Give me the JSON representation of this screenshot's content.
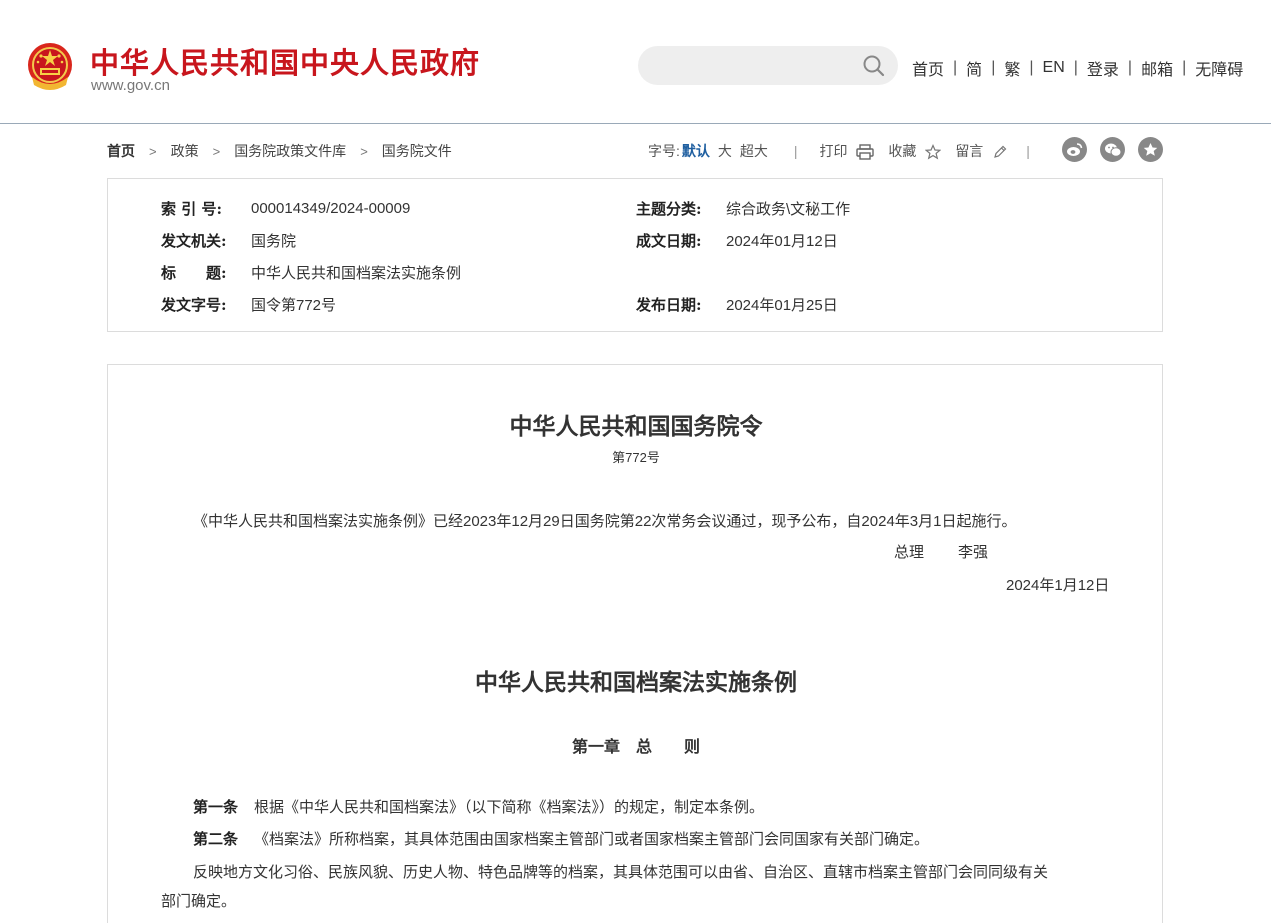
{
  "header": {
    "site_name": "中华人民共和国中央人民政府",
    "domain": "www.gov.cn",
    "search_placeholder": "",
    "nav": [
      "首页",
      "简",
      "繁",
      "EN",
      "登录",
      "邮箱",
      "无障碍"
    ],
    "brand_color": "#c8161d"
  },
  "breadcrumb": [
    "首页",
    "政策",
    "国务院政策文件库",
    "国务院文件"
  ],
  "toolbar": {
    "font_label": "字号:",
    "font_default": "默认",
    "font_large": "大",
    "font_xlarge": "超大",
    "print": "打印",
    "favorite": "收藏",
    "comment": "留言",
    "share_icons": [
      "weibo-icon",
      "wechat-icon",
      "star-icon"
    ]
  },
  "info": {
    "index_label": "索 引 号:",
    "index_value": "000014349/2024-00009",
    "subject_label": "主题分类:",
    "subject_value": "综合政务\\文秘工作",
    "issuer_label": "发文机关:",
    "issuer_value": "国务院",
    "date_written_label": "成文日期:",
    "date_written_value": "2024年01月12日",
    "title_label": "标　　题:",
    "title_value": "中华人民共和国档案法实施条例",
    "doc_no_label": "发文字号:",
    "doc_no_value": "国令第772号",
    "pub_date_label": "发布日期:",
    "pub_date_value": "2024年01月25日"
  },
  "article": {
    "order_title": "中华人民共和国国务院令",
    "order_number": "第772号",
    "intro": "《中华人民共和国档案法实施条例》已经2023年12月29日国务院第22次常务会议通过，现予公布，自2024年3月1日起施行。",
    "signer_title": "总理",
    "signer_name": "李强",
    "sign_date": "2024年1月12日",
    "regulation_title": "中华人民共和国档案法实施条例",
    "chapter_title": "第一章　总　　则",
    "art1_label": "第一条",
    "art1_text": "根据《中华人民共和国档案法》（以下简称《档案法》）的规定，制定本条例。",
    "art2_label": "第二条",
    "art2_text": "《档案法》所称档案，其具体范围由国家档案主管部门或者国家档案主管部门会同国家有关部门确定。",
    "art2_p2_line1": "反映地方文化习俗、民族风貌、历史人物、特色品牌等的档案，其具体范围可以由省、自治区、直辖市档案主管部门会同同级有关",
    "art2_p2_line2": "部门确定。"
  }
}
